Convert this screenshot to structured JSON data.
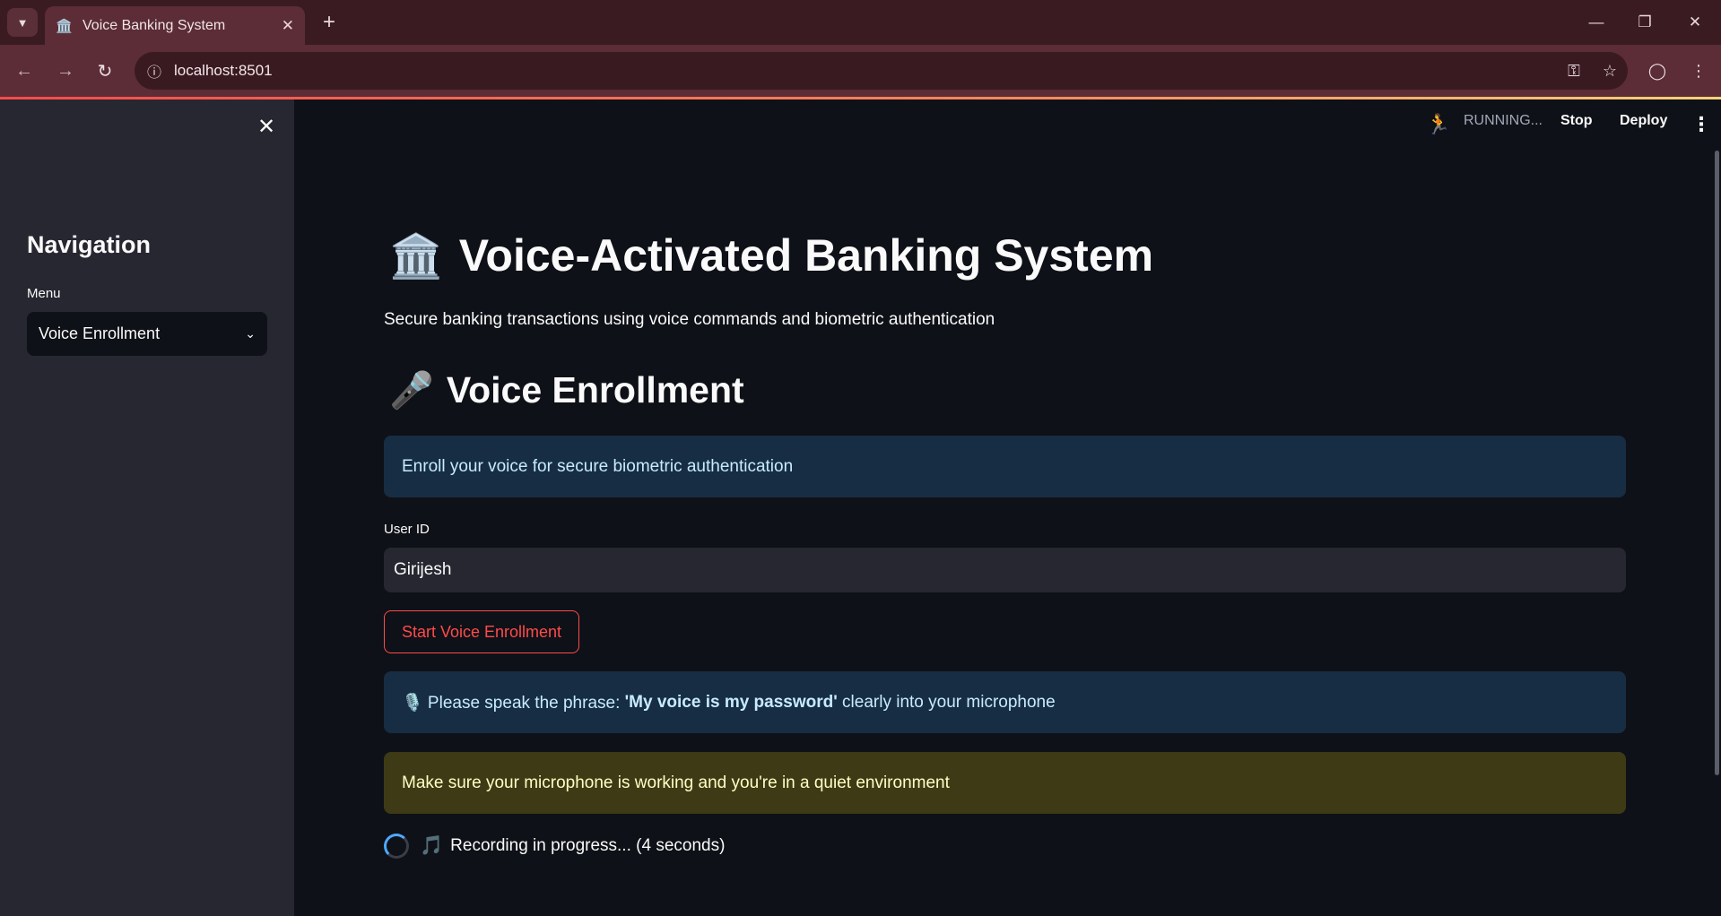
{
  "browser": {
    "tab_title": "Voice Banking System",
    "tab_favicon": "🏛️",
    "url": "localhost:8501",
    "icons": {
      "tab_search": "chevron-down-icon",
      "tab_close": "close-icon",
      "new_tab": "plus-icon",
      "minimize": "minimize-icon",
      "restore": "restore-icon",
      "close": "close-icon",
      "back": "back-arrow-icon",
      "forward": "forward-arrow-icon",
      "reload": "reload-icon",
      "site_info": "info-icon",
      "password": "key-icon",
      "bookmark": "star-icon",
      "profile": "profile-icon",
      "menu": "kebab-menu-icon"
    }
  },
  "toolbar": {
    "status": "RUNNING...",
    "stop_label": "Stop",
    "deploy_label": "Deploy"
  },
  "sidebar": {
    "title": "Navigation",
    "menu_label": "Menu",
    "selected": "Voice Enrollment"
  },
  "main": {
    "title_emoji": "🏛️",
    "title": "Voice-Activated Banking System",
    "subtitle": "Secure banking transactions using voice commands and biometric authentication",
    "section_emoji": "🎤",
    "section_title": "Voice Enrollment",
    "info_message": "Enroll your voice for secure biometric authentication",
    "user_id_label": "User ID",
    "user_id_value": "Girijesh",
    "enroll_button": "Start Voice Enrollment",
    "phrase_prefix": "🎙️ Please speak the phrase: ",
    "phrase": "'My voice is my password'",
    "phrase_suffix": " clearly into your microphone",
    "warning_message": "Make sure your microphone is working and you're in a quiet environment",
    "recording_emoji": "🎵",
    "recording_status": "Recording in progress... (4 seconds)"
  },
  "colors": {
    "primary": "#ff4b4b",
    "background": "#0e1117",
    "sidebar_bg": "#262730",
    "info_bg": "#172d43",
    "warning_bg": "#3e3a16"
  }
}
